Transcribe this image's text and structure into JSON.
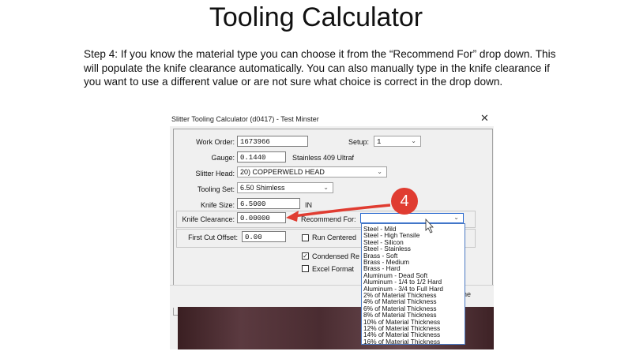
{
  "slide": {
    "title": "Tooling Calculator",
    "step_text": "Step 4: If you know the material type you can choose it from the “Recommend For” drop down. This will populate the knife clearance automatically. You can also manually type in the knife clearance if you want to use a different value or are not sure what choice is correct in the drop down."
  },
  "window": {
    "title": "Slitter Tooling Calculator (d0417) - Test Minster",
    "close_glyph": "✕"
  },
  "form": {
    "work_order_label": "Work Order:",
    "work_order_value": "1673966",
    "setup_label": "Setup:",
    "setup_value": "1",
    "gauge_label": "Gauge:",
    "gauge_value": "0.1440",
    "material_text": "Stainless 409 Ultraf",
    "slitter_head_label": "Slitter Head:",
    "slitter_head_value": "20) COPPERWELD HEAD",
    "tooling_set_label": "Tooling Set:",
    "tooling_set_value": "6.50 Shimless",
    "knife_size_label": "Knife Size:",
    "knife_size_value": "6.5000",
    "knife_size_unit": "IN",
    "knife_clearance_label": "Knife Clearance:",
    "knife_clearance_value": "0.00000",
    "recommend_label": "Recommend For:",
    "recommend_value": "",
    "first_cut_label": "First Cut Offset:",
    "first_cut_value": "0.00",
    "run_centered_label": "Run Centered",
    "condensed_label": "Condensed Re",
    "condensed_checked": "✓",
    "excel_label": "Excel Format",
    "bottom_button_text": "ne"
  },
  "dropdown": {
    "options": [
      "Steel - Mild",
      "Steel - High Tensile",
      "Steel - Silicon",
      "Steel - Stainless",
      "Brass - Soft",
      "Brass - Medium",
      "Brass - Hard",
      "Aluminum - Dead Soft",
      "Aluminum - 1/4 to 1/2 Hard",
      "Aluminum - 3/4 to Full Hard",
      "2% of Material Thickness",
      "4% of Material Thickness",
      "6% of Material Thickness",
      "8% of Material Thickness",
      "10% of Material Thickness",
      "12% of Material Thickness",
      "14% of Material Thickness",
      "16% of Material Thickness"
    ]
  },
  "annotation": {
    "step_number": "4",
    "badge_color": "#e03c31",
    "arrow_color": "#e03c31"
  },
  "icons": {
    "chevron": "chevron-down-icon",
    "cursor": "mouse-cursor-icon"
  }
}
